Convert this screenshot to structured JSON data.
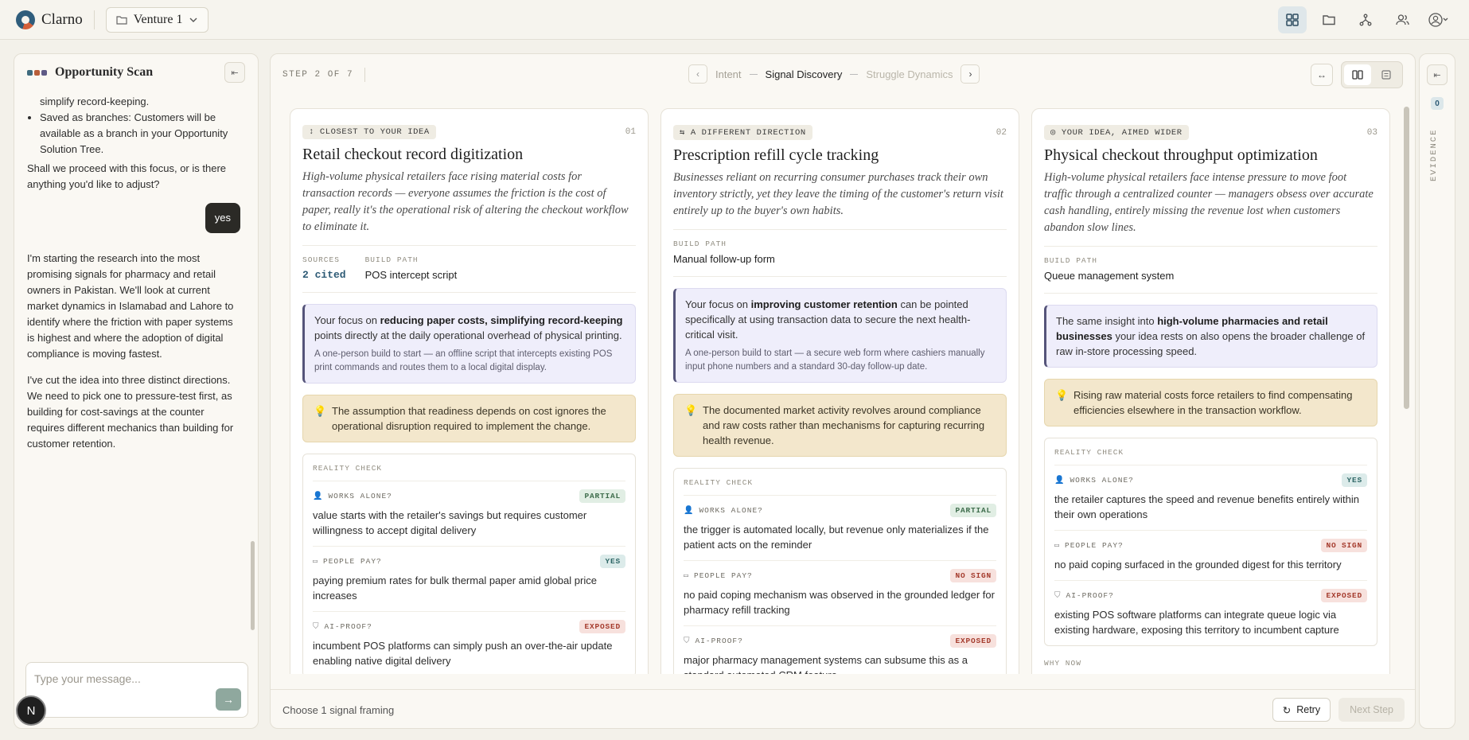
{
  "app": {
    "name": "Clarno",
    "venture": "Venture 1"
  },
  "colors": {
    "accent": "#2d5a75",
    "insight_bg": "#f3e7cc",
    "focus_bg": "#efeefb",
    "dark": "#2b2a26"
  },
  "chat": {
    "title": "Opportunity Scan",
    "list_item_1": "simplify record-keeping.",
    "list_item_2": "Saved as branches: Customers will be available as a branch in your Opportunity Solution Tree.",
    "question": "Shall we proceed with this focus, or is there anything you'd like to adjust?",
    "user_reply": "yes",
    "msg1": "I'm starting the research into the most promising signals for pharmacy and retail owners in Pakistan. We'll look at current market dynamics in Islamabad and Lahore to identify where the friction with paper systems is highest and where the adoption of digital compliance is moving fastest.",
    "msg2": "I've cut the idea into three distinct directions. We need to pick one to pressure-test first, as building for cost-savings at the counter requires different mechanics than building for customer retention.",
    "input_placeholder": "Type your message...",
    "avatar_letter": "N"
  },
  "header": {
    "step_label": "STEP 2 OF 7",
    "steps": {
      "prev": "Intent",
      "current": "Signal Discovery",
      "next": "Struggle Dynamics"
    }
  },
  "labels": {
    "sources": "SOURCES",
    "build_path": "BUILD PATH",
    "reality_check": "REALITY CHECK",
    "works_alone": "WORKS ALONE?",
    "people_pay": "PEOPLE PAY?",
    "ai_proof": "AI-PROOF?",
    "why_now": "WHY NOW"
  },
  "cards": [
    {
      "tag": "CLOSEST TO YOUR IDEA",
      "num": "01",
      "title": "Retail checkout record digitization",
      "desc": "High-volume physical retailers face rising material costs for transaction records — everyone assumes the friction is the cost of paper, really it's the operational risk of altering the checkout workflow to eliminate it.",
      "sources": "2 cited",
      "build_path": "POS intercept script",
      "focus_pre": "Your focus on ",
      "focus_bold": "reducing paper costs, simplifying record-keeping",
      "focus_post": " points directly at the daily operational overhead of physical printing.",
      "focus_sub": "A one-person build to start — an offline script that intercepts existing POS print commands and routes them to a local digital display.",
      "insight": "The assumption that readiness depends on cost ignores the operational disruption required to implement the change.",
      "works_alone": {
        "badge": "PARTIAL",
        "text": "value starts with the retailer's savings but requires customer willingness to accept digital delivery"
      },
      "people_pay": {
        "badge": "YES",
        "text": "paying premium rates for bulk thermal paper amid global price increases"
      },
      "ai_proof": {
        "badge": "EXPOSED",
        "text": "incumbent POS platforms can simply push an over-the-air update enabling native digital delivery"
      }
    },
    {
      "tag": "A DIFFERENT DIRECTION",
      "num": "02",
      "title": "Prescription refill cycle tracking",
      "desc": "Businesses reliant on recurring consumer purchases track their own inventory strictly, yet they leave the timing of the customer's return visit entirely up to the buyer's own habits.",
      "build_path": "Manual follow-up form",
      "focus_pre": "Your focus on ",
      "focus_bold": "improving customer retention",
      "focus_post": " can be pointed specifically at using transaction data to secure the next health-critical visit.",
      "focus_sub": "A one-person build to start — a secure web form where cashiers manually input phone numbers and a standard 30-day follow-up date.",
      "insight": "The documented market activity revolves around compliance and raw costs rather than mechanisms for capturing recurring health revenue.",
      "works_alone": {
        "badge": "PARTIAL",
        "text": "the trigger is automated locally, but revenue only materializes if the patient acts on the reminder"
      },
      "people_pay": {
        "badge": "NO SIGN",
        "text": "no paid coping mechanism was observed in the grounded ledger for pharmacy refill tracking"
      },
      "ai_proof": {
        "badge": "EXPOSED",
        "text": "major pharmacy management systems can subsume this as a standard automated CRM feature"
      }
    },
    {
      "tag": "YOUR IDEA, AIMED WIDER",
      "num": "03",
      "title": "Physical checkout throughput optimization",
      "desc": "High-volume physical retailers face intense pressure to move foot traffic through a centralized counter — managers obsess over accurate cash handling, entirely missing the revenue lost when customers abandon slow lines.",
      "build_path": "Queue management system",
      "focus_pre": "The same insight into ",
      "focus_bold": "high-volume pharmacies and retail businesses",
      "focus_post": " your idea rests on also opens the broader challenge of raw in-store processing speed.",
      "insight": "Rising raw material costs force retailers to find compensating efficiencies elsewhere in the transaction workflow.",
      "works_alone": {
        "badge": "YES",
        "text": "the retailer captures the speed and revenue benefits entirely within their own operations"
      },
      "people_pay": {
        "badge": "NO SIGN",
        "text": "no paid coping surfaced in the grounded digest for this territory"
      },
      "ai_proof": {
        "badge": "EXPOSED",
        "text": "existing POS software platforms can integrate queue logic via existing hardware, exposing this territory to incumbent capture"
      }
    }
  ],
  "footer": {
    "prompt": "Choose 1 signal framing",
    "retry": "Retry",
    "next": "Next Step"
  },
  "evidence": {
    "count": "0",
    "label": "EVIDENCE"
  }
}
